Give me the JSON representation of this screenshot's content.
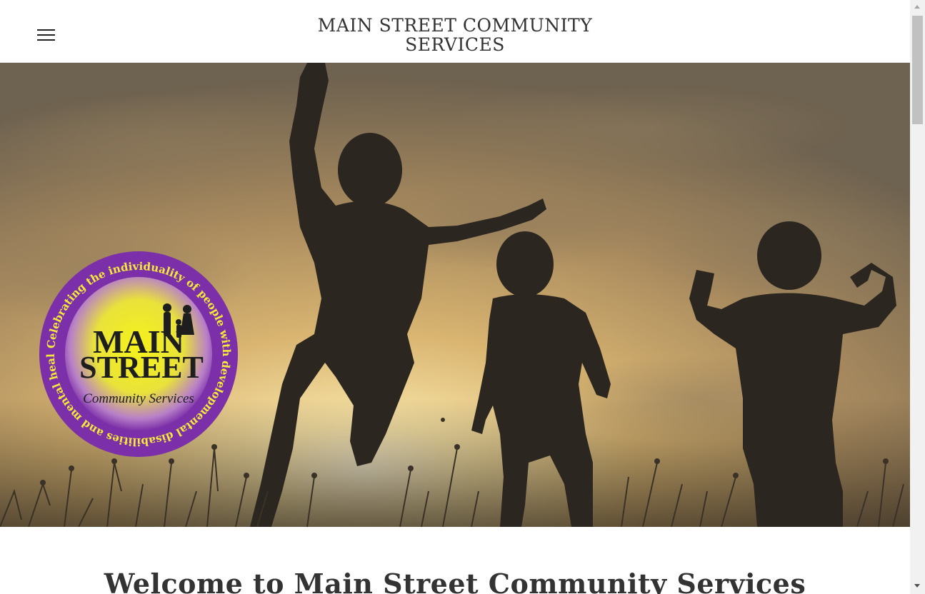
{
  "header": {
    "title_line1": "MAIN STREET COMMUNITY",
    "title_line2": "SERVICES",
    "menu_icon": "hamburger-menu-icon"
  },
  "hero": {
    "image_description_icon": "children-jumping-sunset-photo",
    "logo": {
      "arc_text": "Celebrating the individuality of people with developmental disabilities and mental health needs.",
      "word1": "MAIN",
      "word2": "STREET",
      "subtitle": "Community Services"
    }
  },
  "main": {
    "welcome_heading": "Welcome to Main Street Community Services"
  },
  "colors": {
    "logo_purple": "#7b2fa8",
    "logo_yellow": "#f3f01a",
    "text_dark": "#333333"
  }
}
